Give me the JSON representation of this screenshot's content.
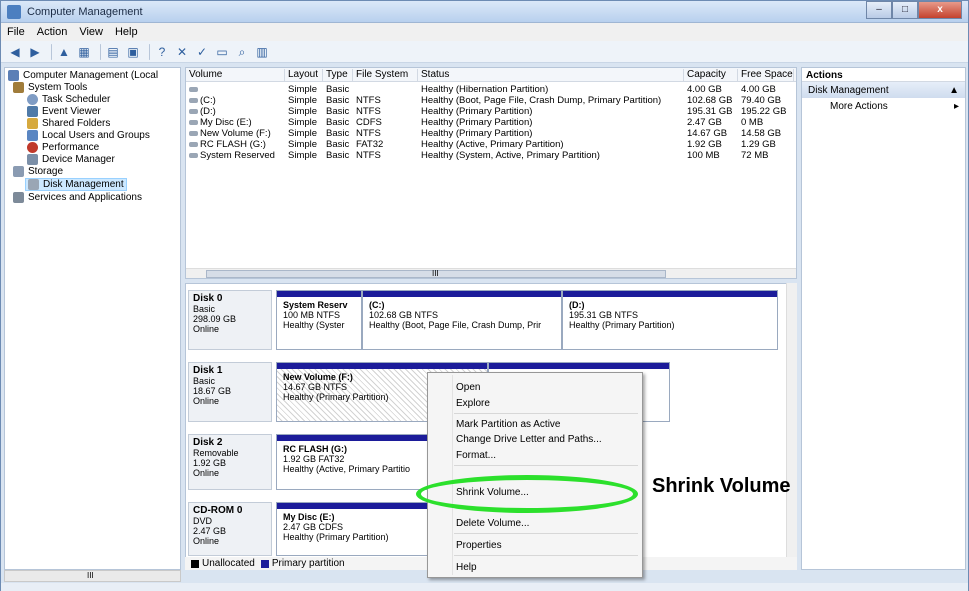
{
  "window": {
    "title": "Computer Management",
    "min": "–",
    "max": "□",
    "close": "x"
  },
  "menu": [
    "File",
    "Action",
    "View",
    "Help"
  ],
  "tree": {
    "root": "Computer Management (Local",
    "system_tools": "System Tools",
    "task_scheduler": "Task Scheduler",
    "event_viewer": "Event Viewer",
    "shared_folders": "Shared Folders",
    "local_users": "Local Users and Groups",
    "performance": "Performance",
    "device_manager": "Device Manager",
    "storage": "Storage",
    "disk_management": "Disk Management",
    "services": "Services and Applications",
    "scroll_mid": "III"
  },
  "volumes": {
    "headers": [
      "Volume",
      "Layout",
      "Type",
      "File System",
      "Status",
      "Capacity",
      "Free Space",
      "%"
    ],
    "rows": [
      [
        "",
        "Simple",
        "Basic",
        "",
        "Healthy (Hibernation Partition)",
        "4.00 GB",
        "4.00 GB"
      ],
      [
        "(C:)",
        "Simple",
        "Basic",
        "NTFS",
        "Healthy (Boot, Page File, Crash Dump, Primary Partition)",
        "102.68 GB",
        "79.40 GB"
      ],
      [
        "(D:)",
        "Simple",
        "Basic",
        "NTFS",
        "Healthy (Primary Partition)",
        "195.31 GB",
        "195.22 GB"
      ],
      [
        "My Disc (E:)",
        "Simple",
        "Basic",
        "CDFS",
        "Healthy (Primary Partition)",
        "2.47 GB",
        "0 MB"
      ],
      [
        "New Volume (F:)",
        "Simple",
        "Basic",
        "NTFS",
        "Healthy (Primary Partition)",
        "14.67 GB",
        "14.58 GB"
      ],
      [
        "RC FLASH (G:)",
        "Simple",
        "Basic",
        "FAT32",
        "Healthy (Active, Primary Partition)",
        "1.92 GB",
        "1.29 GB"
      ],
      [
        "System Reserved",
        "Simple",
        "Basic",
        "NTFS",
        "Healthy (System, Active, Primary Partition)",
        "100 MB",
        "72 MB"
      ]
    ],
    "scroll_mid": "III"
  },
  "disks": {
    "disk0": {
      "name": "Disk 0",
      "type": "Basic",
      "size": "298.09 GB",
      "state": "Online",
      "p1": {
        "name": "System Reserv",
        "l2": "100 MB NTFS",
        "l3": "Healthy (Syster"
      },
      "p2": {
        "name": "(C:)",
        "l2": "102.68 GB NTFS",
        "l3": "Healthy (Boot, Page File, Crash Dump, Prir"
      },
      "p3": {
        "name": "(D:)",
        "l2": "195.31 GB NTFS",
        "l3": "Healthy (Primary Partition)"
      }
    },
    "disk1": {
      "name": "Disk 1",
      "type": "Basic",
      "size": "18.67 GB",
      "state": "Online",
      "p1": {
        "name": "New Volume  (F:)",
        "l2": "14.67 GB NTFS",
        "l3": "Healthy (Primary Partition)"
      }
    },
    "disk2": {
      "name": "Disk 2",
      "type": "Removable",
      "size": "1.92 GB",
      "state": "Online",
      "p1": {
        "name": "RC FLASH  (G:)",
        "l2": "1.92 GB FAT32",
        "l3": "Healthy (Active, Primary Partitio"
      }
    },
    "cdrom0": {
      "name": "CD-ROM 0",
      "type": "DVD",
      "size": "2.47 GB",
      "state": "Online",
      "p1": {
        "name": "My Disc  (E:)",
        "l2": "2.47 GB CDFS",
        "l3": "Healthy (Primary Partition)"
      }
    },
    "legend_unallocated": "Unallocated",
    "legend_primary": "Primary partition"
  },
  "actions": {
    "header": "Actions",
    "section": "Disk Management",
    "more": "More Actions"
  },
  "context_menu": {
    "open": "Open",
    "explore": "Explore",
    "mark_active": "Mark Partition as Active",
    "change_letter": "Change Drive Letter and Paths...",
    "format": "Format...",
    "shrink": "Shrink Volume...",
    "delete": "Delete Volume...",
    "properties": "Properties",
    "help": "Help"
  },
  "annotation": {
    "callout": "Shrink Volume"
  },
  "colors": {
    "highlight": "#2ce02c",
    "primary_partition": "#1c1c9a",
    "unallocated": "#000000"
  }
}
